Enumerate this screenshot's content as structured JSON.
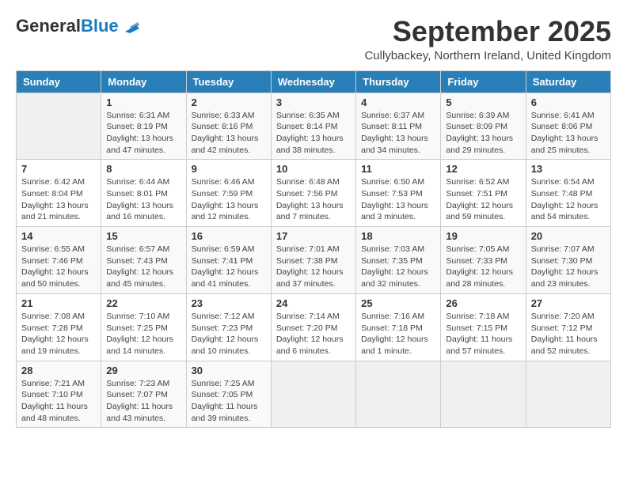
{
  "header": {
    "logo_general": "General",
    "logo_blue": "Blue",
    "month_title": "September 2025",
    "location": "Cullybackey, Northern Ireland, United Kingdom"
  },
  "weekdays": [
    "Sunday",
    "Monday",
    "Tuesday",
    "Wednesday",
    "Thursday",
    "Friday",
    "Saturday"
  ],
  "weeks": [
    [
      {
        "day": "",
        "detail": ""
      },
      {
        "day": "1",
        "detail": "Sunrise: 6:31 AM\nSunset: 8:19 PM\nDaylight: 13 hours\nand 47 minutes."
      },
      {
        "day": "2",
        "detail": "Sunrise: 6:33 AM\nSunset: 8:16 PM\nDaylight: 13 hours\nand 42 minutes."
      },
      {
        "day": "3",
        "detail": "Sunrise: 6:35 AM\nSunset: 8:14 PM\nDaylight: 13 hours\nand 38 minutes."
      },
      {
        "day": "4",
        "detail": "Sunrise: 6:37 AM\nSunset: 8:11 PM\nDaylight: 13 hours\nand 34 minutes."
      },
      {
        "day": "5",
        "detail": "Sunrise: 6:39 AM\nSunset: 8:09 PM\nDaylight: 13 hours\nand 29 minutes."
      },
      {
        "day": "6",
        "detail": "Sunrise: 6:41 AM\nSunset: 8:06 PM\nDaylight: 13 hours\nand 25 minutes."
      }
    ],
    [
      {
        "day": "7",
        "detail": "Sunrise: 6:42 AM\nSunset: 8:04 PM\nDaylight: 13 hours\nand 21 minutes."
      },
      {
        "day": "8",
        "detail": "Sunrise: 6:44 AM\nSunset: 8:01 PM\nDaylight: 13 hours\nand 16 minutes."
      },
      {
        "day": "9",
        "detail": "Sunrise: 6:46 AM\nSunset: 7:59 PM\nDaylight: 13 hours\nand 12 minutes."
      },
      {
        "day": "10",
        "detail": "Sunrise: 6:48 AM\nSunset: 7:56 PM\nDaylight: 13 hours\nand 7 minutes."
      },
      {
        "day": "11",
        "detail": "Sunrise: 6:50 AM\nSunset: 7:53 PM\nDaylight: 13 hours\nand 3 minutes."
      },
      {
        "day": "12",
        "detail": "Sunrise: 6:52 AM\nSunset: 7:51 PM\nDaylight: 12 hours\nand 59 minutes."
      },
      {
        "day": "13",
        "detail": "Sunrise: 6:54 AM\nSunset: 7:48 PM\nDaylight: 12 hours\nand 54 minutes."
      }
    ],
    [
      {
        "day": "14",
        "detail": "Sunrise: 6:55 AM\nSunset: 7:46 PM\nDaylight: 12 hours\nand 50 minutes."
      },
      {
        "day": "15",
        "detail": "Sunrise: 6:57 AM\nSunset: 7:43 PM\nDaylight: 12 hours\nand 45 minutes."
      },
      {
        "day": "16",
        "detail": "Sunrise: 6:59 AM\nSunset: 7:41 PM\nDaylight: 12 hours\nand 41 minutes."
      },
      {
        "day": "17",
        "detail": "Sunrise: 7:01 AM\nSunset: 7:38 PM\nDaylight: 12 hours\nand 37 minutes."
      },
      {
        "day": "18",
        "detail": "Sunrise: 7:03 AM\nSunset: 7:35 PM\nDaylight: 12 hours\nand 32 minutes."
      },
      {
        "day": "19",
        "detail": "Sunrise: 7:05 AM\nSunset: 7:33 PM\nDaylight: 12 hours\nand 28 minutes."
      },
      {
        "day": "20",
        "detail": "Sunrise: 7:07 AM\nSunset: 7:30 PM\nDaylight: 12 hours\nand 23 minutes."
      }
    ],
    [
      {
        "day": "21",
        "detail": "Sunrise: 7:08 AM\nSunset: 7:28 PM\nDaylight: 12 hours\nand 19 minutes."
      },
      {
        "day": "22",
        "detail": "Sunrise: 7:10 AM\nSunset: 7:25 PM\nDaylight: 12 hours\nand 14 minutes."
      },
      {
        "day": "23",
        "detail": "Sunrise: 7:12 AM\nSunset: 7:23 PM\nDaylight: 12 hours\nand 10 minutes."
      },
      {
        "day": "24",
        "detail": "Sunrise: 7:14 AM\nSunset: 7:20 PM\nDaylight: 12 hours\nand 6 minutes."
      },
      {
        "day": "25",
        "detail": "Sunrise: 7:16 AM\nSunset: 7:18 PM\nDaylight: 12 hours\nand 1 minute."
      },
      {
        "day": "26",
        "detail": "Sunrise: 7:18 AM\nSunset: 7:15 PM\nDaylight: 11 hours\nand 57 minutes."
      },
      {
        "day": "27",
        "detail": "Sunrise: 7:20 AM\nSunset: 7:12 PM\nDaylight: 11 hours\nand 52 minutes."
      }
    ],
    [
      {
        "day": "28",
        "detail": "Sunrise: 7:21 AM\nSunset: 7:10 PM\nDaylight: 11 hours\nand 48 minutes."
      },
      {
        "day": "29",
        "detail": "Sunrise: 7:23 AM\nSunset: 7:07 PM\nDaylight: 11 hours\nand 43 minutes."
      },
      {
        "day": "30",
        "detail": "Sunrise: 7:25 AM\nSunset: 7:05 PM\nDaylight: 11 hours\nand 39 minutes."
      },
      {
        "day": "",
        "detail": ""
      },
      {
        "day": "",
        "detail": ""
      },
      {
        "day": "",
        "detail": ""
      },
      {
        "day": "",
        "detail": ""
      }
    ]
  ]
}
